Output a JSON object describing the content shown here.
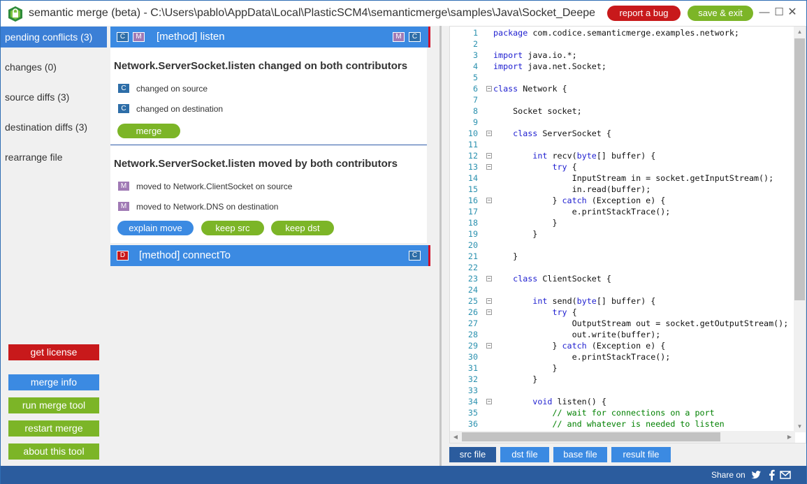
{
  "window": {
    "title": "semantic merge (beta) - C:\\Users\\pablo\\AppData\\Local\\PlasticSCM4\\semanticmerge\\samples\\Java\\Socket_Deeper...",
    "report_bug_label": "report a bug",
    "save_exit_label": "save & exit",
    "minimize_glyph": "—",
    "maximize_glyph": "☐",
    "close_glyph": "✕"
  },
  "sidebar": {
    "items": [
      {
        "label": "pending conflicts (3)"
      },
      {
        "label": "changes (0)"
      },
      {
        "label": "source diffs (3)"
      },
      {
        "label": "destination diffs (3)"
      },
      {
        "label": "rearrange file"
      }
    ],
    "buttons": {
      "get_license": "get license",
      "merge_info": "merge info",
      "run_merge_tool": "run merge tool",
      "restart_merge": "restart merge",
      "about": "about this tool"
    }
  },
  "conflicts": {
    "first": {
      "badges_left": [
        "C",
        "M"
      ],
      "badges_right": [
        "M",
        "C"
      ],
      "title": "[method] listen",
      "section1": {
        "title": "Network.ServerSocket.listen changed on both contributors",
        "rows": [
          {
            "badge": "C",
            "text": "changed on source"
          },
          {
            "badge": "C",
            "text": "changed on destination"
          }
        ],
        "buttons": [
          "merge"
        ]
      },
      "section2": {
        "title": "Network.ServerSocket.listen  moved by both contributors",
        "rows": [
          {
            "badge": "M",
            "text": "moved to Network.ClientSocket on source"
          },
          {
            "badge": "M",
            "text": "moved to Network.DNS on destination"
          }
        ],
        "buttons": [
          "explain move",
          "keep src",
          "keep dst"
        ]
      }
    },
    "second": {
      "badge_left": "D",
      "badge_right": "C",
      "title": "[method] connectTo"
    }
  },
  "editor": {
    "lines": [
      {
        "n": "1",
        "code": "package com.codice.semanticmerge.examples.network;"
      },
      {
        "n": "2",
        "code": ""
      },
      {
        "n": "3",
        "code": "import java.io.*;"
      },
      {
        "n": "4",
        "code": "import java.net.Socket;"
      },
      {
        "n": "5",
        "code": ""
      },
      {
        "n": "6",
        "code": "class Network {"
      },
      {
        "n": "7",
        "code": ""
      },
      {
        "n": "8",
        "code": "    Socket socket;"
      },
      {
        "n": "9",
        "code": ""
      },
      {
        "n": "10",
        "code": "    class ServerSocket {"
      },
      {
        "n": "11",
        "code": ""
      },
      {
        "n": "12",
        "code": "        int recv(byte[] buffer) {"
      },
      {
        "n": "13",
        "code": "            try {"
      },
      {
        "n": "14",
        "code": "                InputStream in = socket.getInputStream();"
      },
      {
        "n": "15",
        "code": "                in.read(buffer);"
      },
      {
        "n": "16",
        "code": "            } catch (Exception e) {"
      },
      {
        "n": "17",
        "code": "                e.printStackTrace();"
      },
      {
        "n": "18",
        "code": "            }"
      },
      {
        "n": "19",
        "code": "        }"
      },
      {
        "n": "20",
        "code": ""
      },
      {
        "n": "21",
        "code": "    }"
      },
      {
        "n": "22",
        "code": ""
      },
      {
        "n": "23",
        "code": "    class ClientSocket {"
      },
      {
        "n": "24",
        "code": ""
      },
      {
        "n": "25",
        "code": "        int send(byte[] buffer) {"
      },
      {
        "n": "26",
        "code": "            try {"
      },
      {
        "n": "27",
        "code": "                OutputStream out = socket.getOutputStream();"
      },
      {
        "n": "28",
        "code": "                out.write(buffer);"
      },
      {
        "n": "29",
        "code": "            } catch (Exception e) {"
      },
      {
        "n": "30",
        "code": "                e.printStackTrace();"
      },
      {
        "n": "31",
        "code": "            }"
      },
      {
        "n": "32",
        "code": "        }"
      },
      {
        "n": "33",
        "code": ""
      },
      {
        "n": "34",
        "code": "        void listen() {"
      },
      {
        "n": "35",
        "code": "            // wait for connections on a port"
      },
      {
        "n": "36",
        "code": "            // and whatever is needed to listen"
      }
    ],
    "tabs": [
      "src file",
      "dst file",
      "base file",
      "result file"
    ],
    "active_tab": "src file"
  },
  "footer": {
    "share_label": "Share on",
    "icons": [
      "twitter-icon",
      "facebook-icon",
      "mail-icon"
    ]
  },
  "colors": {
    "accent_blue": "#3b8ae2",
    "dark_blue": "#2b5c9e",
    "green": "#7cb527",
    "red": "#c8191b",
    "modified_badge": "#a07ab5",
    "changed_badge": "#2e6ea8"
  }
}
